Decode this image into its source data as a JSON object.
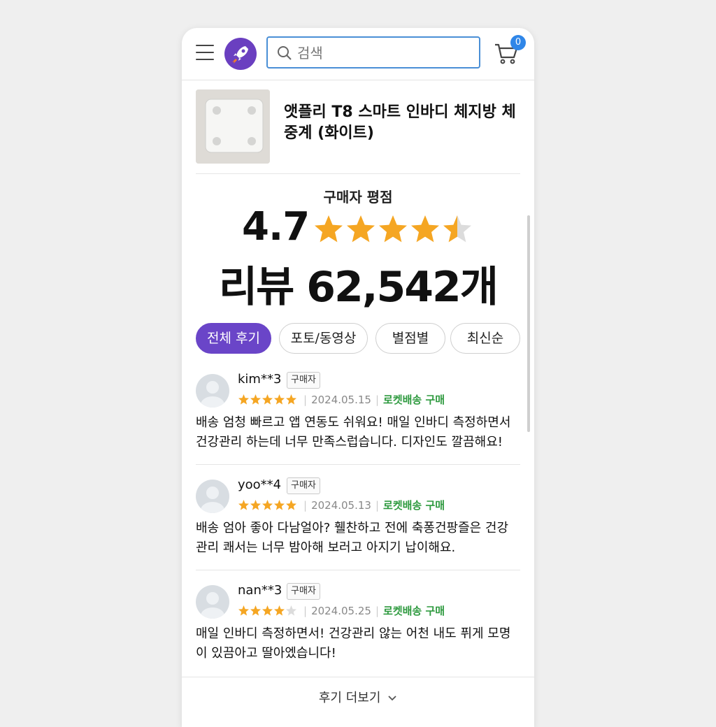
{
  "header": {
    "search_placeholder": "검색",
    "cart_count": "0"
  },
  "product": {
    "title": "앳플리 T8 스마트 인바디 체지방 체중계 (화이트)"
  },
  "rating": {
    "label": "구매자 평점",
    "score": "4.7",
    "stars": 4.5,
    "review_count": "리뷰 62,542개"
  },
  "filters": [
    {
      "label": "전체 후기",
      "active": true
    },
    {
      "label": "포토/동영상",
      "active": false
    },
    {
      "label": "별점별",
      "active": false
    },
    {
      "label": "최신순",
      "active": false
    }
  ],
  "reviews": [
    {
      "user": "kim**3",
      "tag": "구매자",
      "stars": 5,
      "date": "2024.05.15",
      "delivery": "로켓배송 구매",
      "text": "배송 엄청 빠르고 앱 연동도 쉬워요! 매일 인바디 측정하면서 건강관리 하는데 너무 만족스럽습니다. 디자인도 깔끔해요!"
    },
    {
      "user": "yoo**4",
      "tag": "구매자",
      "stars": 5,
      "date": "2024.05.13",
      "delivery": "로켓배송 구매",
      "text": "배송 엄아 좋아 다남얼아? 휄찬하고 전에 축퐁건팡즐은 건강 관리 쾌서는 너무 밤아해 보러고 아지기 납이해요."
    },
    {
      "user": "nan**3",
      "tag": "구매자",
      "stars": 4,
      "date": "2024.05.25",
      "delivery": "로켓배송 구매",
      "text": "매일 인바디 측정하면서! 건강관리 않는 어천 내도 퓌게 모명이 있끔아고 딸아엤습니다!"
    }
  ],
  "more_label": "후기 더보기",
  "colors": {
    "accent": "#6a45c8",
    "star": "#f5a623",
    "rocket_green": "#2e9a3f",
    "badge_blue": "#2f86e8"
  }
}
